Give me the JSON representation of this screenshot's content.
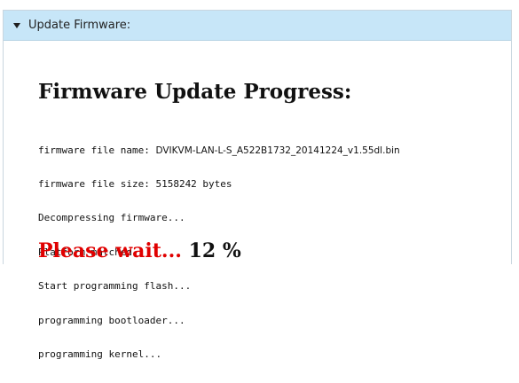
{
  "header": {
    "title": "Update Firmware:"
  },
  "main": {
    "heading": "Firmware Update Progress:",
    "log": {
      "filename_prefix": "firmware file name: ",
      "filename": "DVIKVM-LAN-L-S_A522B1732_20141224_v1.55dl.bin",
      "lines": [
        "firmware file size: 5158242 bytes",
        "Decompressing firmware...",
        "Platform matched.",
        "Start programming flash...",
        "programming bootloader...",
        "programming kernel..."
      ]
    },
    "status": {
      "wait_text": "Please wait...",
      "percent": "12 %"
    },
    "progress_fraction": 0.12
  }
}
